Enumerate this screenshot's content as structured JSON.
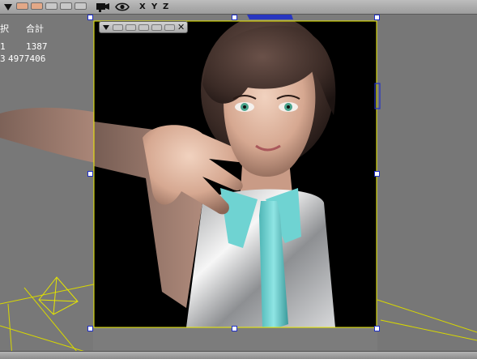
{
  "toolbar": {
    "menu_arrow_icon": "triangle-down-icon",
    "swatches": [
      "#e3a887",
      "#e3a887",
      "#c8c8c8",
      "#c8c8c8"
    ],
    "camera_icon": "camera-icon",
    "eye_icon": "eye-icon",
    "axis_x": "X",
    "axis_y": "Y",
    "axis_z": "Z"
  },
  "stats": {
    "header_partial": "択",
    "header_total": "合計",
    "row1_partial": "1",
    "row1_total": "1387",
    "row2_partial": "3",
    "row2_total": "4977406"
  },
  "mini_panel": {
    "menu_icon": "triangle-down-icon",
    "close_icon": "close-icon",
    "close_label": "✕"
  },
  "colors": {
    "viewport_bg": "#7a7a7a",
    "selection_border": "#f0f000",
    "handle_border": "#1f2fc8",
    "grid_line": "#d8d800",
    "render_bg": "#000000",
    "tie_accent": "#6fd3d2"
  }
}
